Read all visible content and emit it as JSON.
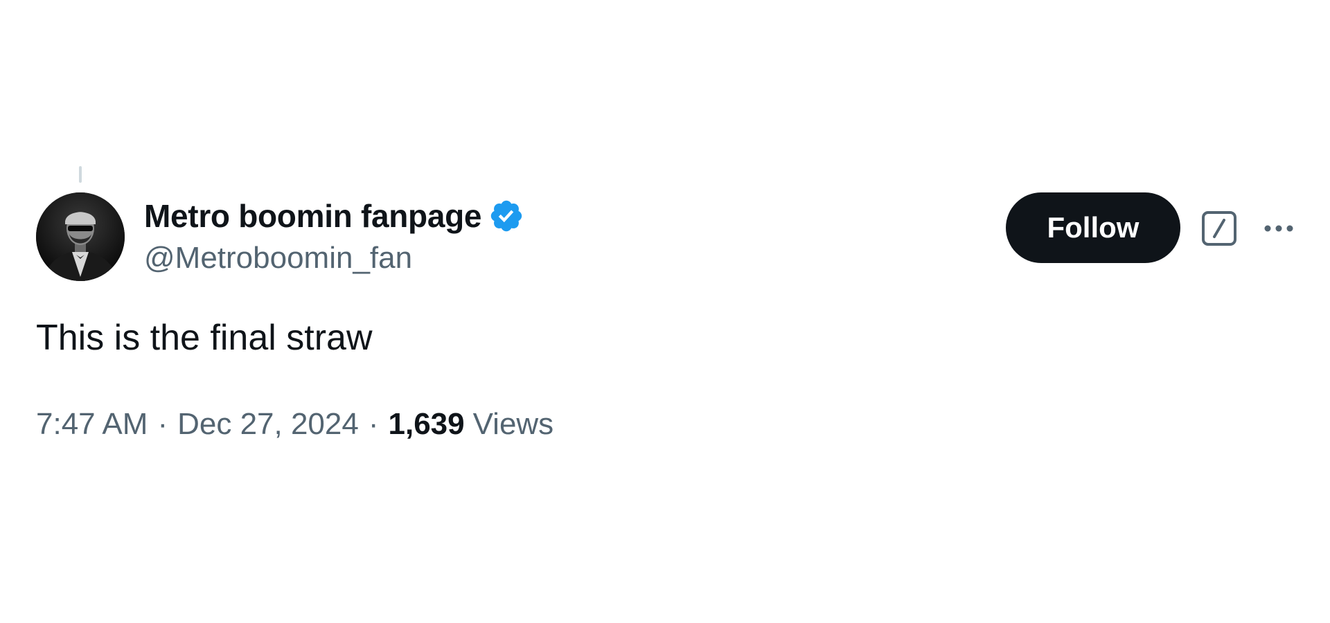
{
  "tweet": {
    "author": {
      "display_name": "Metro boomin fanpage",
      "handle": "@Metroboomin_fan",
      "verified": true,
      "verified_color": "#1d9bf0"
    },
    "follow_label": "Follow",
    "text": "This is the final straw",
    "time": "7:47 AM",
    "separator": "·",
    "date": "Dec 27, 2024",
    "views_count": "1,639",
    "views_label": "Views"
  },
  "icons": {
    "grok": "grok-icon",
    "more": "more-options-icon",
    "verified": "verified-badge-icon"
  },
  "colors": {
    "text_primary": "#0f1419",
    "text_secondary": "#536471",
    "button_bg": "#0f1419",
    "thread_line": "#cfd9de"
  }
}
